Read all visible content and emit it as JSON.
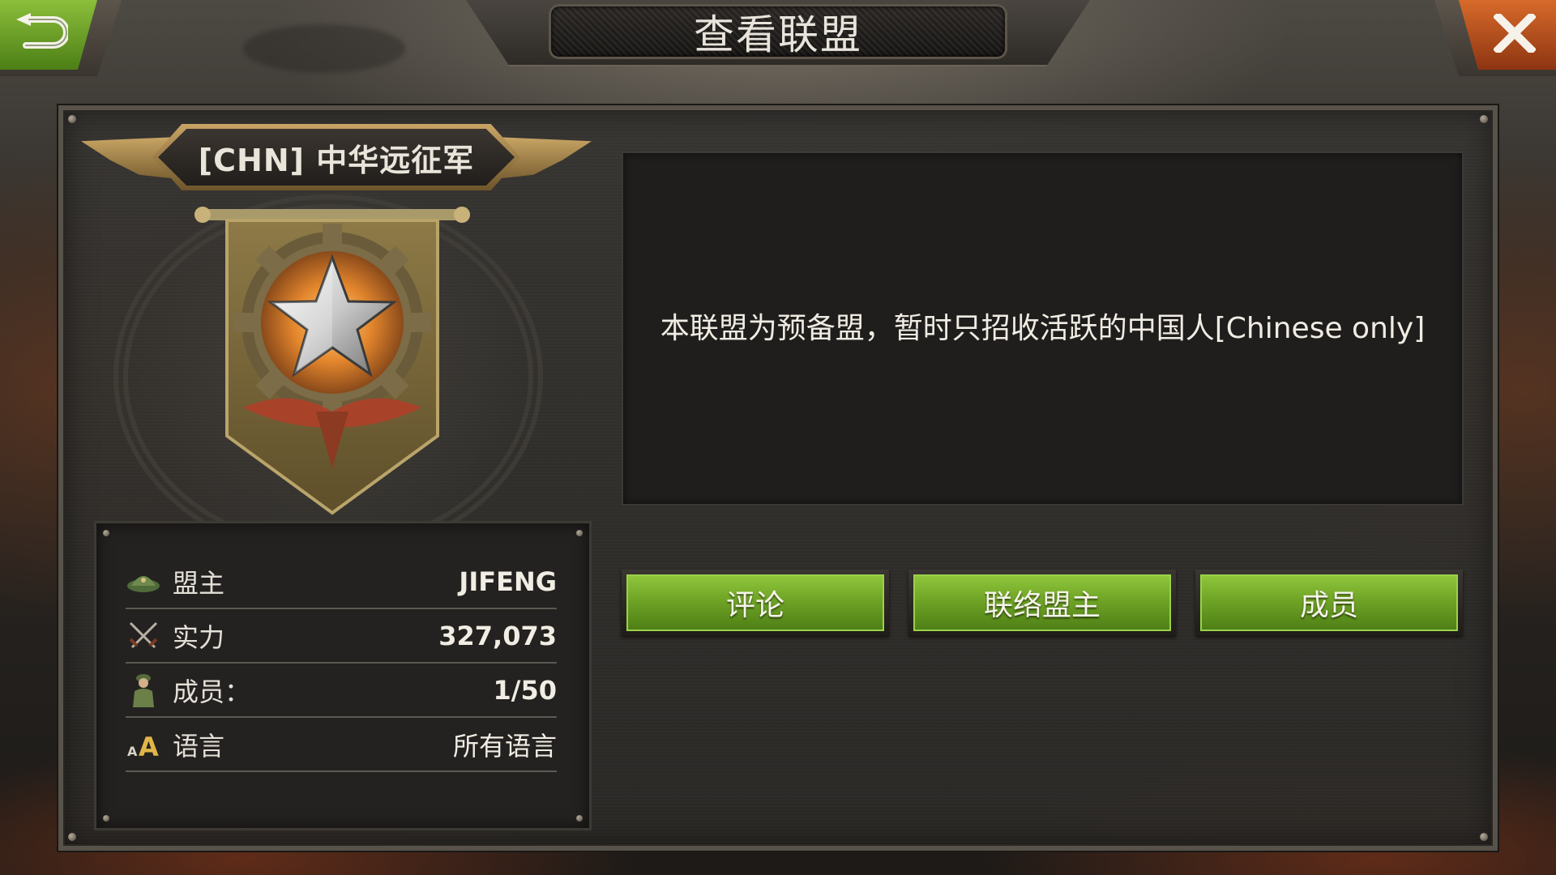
{
  "header": {
    "title": "查看联盟",
    "back_icon": "back-arrow-icon",
    "close_icon": "close-icon",
    "close_glyph": "X"
  },
  "alliance": {
    "name": "[CHN] 中华远征军",
    "emblem_icon": "star-gear-emblem-icon",
    "description": "本联盟为预备盟，暂时只招收活跃的中国人[Chinese only]"
  },
  "stats": [
    {
      "label": "盟主",
      "value": "JIFENG",
      "icon": "helmet-icon"
    },
    {
      "label": "实力",
      "value": "327,073",
      "icon": "crossed-swords-icon"
    },
    {
      "label": "成员：",
      "value": "1/50",
      "icon": "soldier-icon"
    },
    {
      "label": "语言",
      "value": "所有语言",
      "icon": "language-icon"
    }
  ],
  "buttons": {
    "comment": "评论",
    "contact_leader": "联络盟主",
    "members": "成员"
  },
  "colors": {
    "button_green": "#6fa426",
    "close_orange": "#c4561f",
    "back_green": "#6ea429",
    "gold_trim": "#c9a465"
  }
}
